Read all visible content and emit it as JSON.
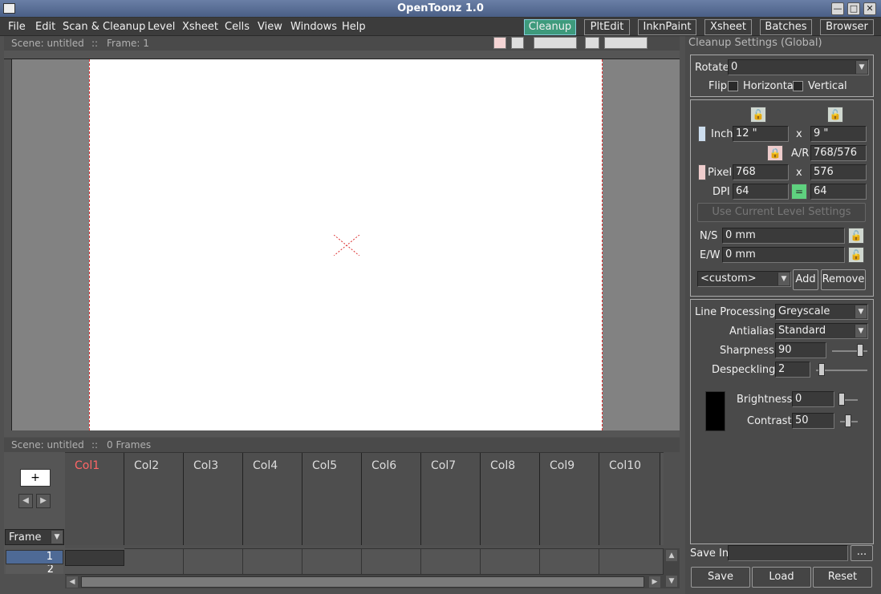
{
  "window": {
    "title": "OpenToonz 1.0",
    "controls": {
      "minimize": "—",
      "maximize": "□",
      "close": "✕"
    }
  },
  "menu": {
    "items": [
      "File",
      "Edit",
      "Scan & Cleanup",
      "Level",
      "Xsheet",
      "Cells",
      "View",
      "Windows",
      "Help"
    ],
    "rooms": [
      "Cleanup",
      "PltEdit",
      "InknPaint",
      "Xsheet",
      "Batches",
      "Browser"
    ],
    "active_room": "Cleanup"
  },
  "viewer": {
    "scene_label": "Scene: untitled",
    "separator": "::",
    "frame_label": "Frame: 1"
  },
  "xsheet": {
    "scene_label": "Scene: untitled",
    "separator": "::",
    "frames_label": "0 Frames",
    "columns": [
      "Col1",
      "Col2",
      "Col3",
      "Col4",
      "Col5",
      "Col6",
      "Col7",
      "Col8",
      "Col9",
      "Col10"
    ],
    "frame_mode": "Frame",
    "row_numbers": [
      "1",
      "2"
    ]
  },
  "cleanup": {
    "title": "Cleanup Settings (Global)",
    "rotate_label": "Rotate",
    "rotate_value": "0",
    "flip_label": "Flip",
    "horizontal_label": "Horizontal",
    "vertical_label": "Vertical",
    "inch_label": "Inch",
    "inch_w": "12 \"",
    "inch_h": "9 \"",
    "x_label": "x",
    "ar_label": "A/R",
    "ar_value": "768/576",
    "pixel_label": "Pixel",
    "pixel_w": "768",
    "pixel_h": "576",
    "dpi_label": "DPI",
    "dpi_w": "64",
    "dpi_h": "64",
    "use_current_label": "Use Current Level Settings",
    "ns_label": "N/S",
    "ns_value": "0 mm",
    "ew_label": "E/W",
    "ew_value": "0 mm",
    "preset_value": "<custom>",
    "add_label": "Add",
    "remove_label": "Remove",
    "line_processing_label": "Line Processing:",
    "line_processing_value": "Greyscale",
    "antialias_label": "Antialias:",
    "antialias_value": "Standard",
    "sharpness_label": "Sharpness:",
    "sharpness_value": "90",
    "despeckling_label": "Despeckling:",
    "despeckling_value": "2",
    "brightness_label": "Brightness:",
    "brightness_value": "0",
    "contrast_label": "Contrast:",
    "contrast_value": "50",
    "save_in_label": "Save In",
    "save_in_value": "",
    "browse_label": "...",
    "save_label": "Save",
    "load_label": "Load",
    "reset_label": "Reset"
  }
}
